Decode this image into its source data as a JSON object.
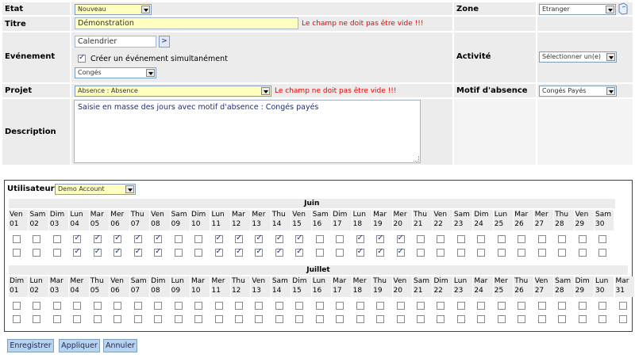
{
  "form": {
    "etat_label": "Etat",
    "etat_value": "Nouveau",
    "zone_label": "Zone",
    "zone_value": "Etranger",
    "titre_label": "Titre",
    "titre_value": "Démonstration",
    "titre_error": "Le champ ne doit pas être vide !!!",
    "evenement_label": "Evénement",
    "calendrier_value": "Calendrier",
    "calendrier_button": ">",
    "simultane_label": "Créer un événement simultanément",
    "evenement_type": "Congés",
    "activite_label": "Activité",
    "activite_value": "Sélectionner un(e)",
    "projet_label": "Projet",
    "projet_value": "Absence : Absence",
    "projet_error": "Le champ ne doit pas être vide !!!",
    "motif_label": "Motif d'absence",
    "motif_value": "Congés Payés",
    "description_label": "Description",
    "description_value": "Saisie en masse des jours avec motif d'absence : Congés payés"
  },
  "planning": {
    "user_label": "Utilisateur",
    "user_value": "Demo Account",
    "months": [
      {
        "name": "Juin",
        "days": [
          [
            "Ven",
            "01"
          ],
          [
            "Sam",
            "02"
          ],
          [
            "Dim",
            "03"
          ],
          [
            "Lun",
            "04"
          ],
          [
            "Mar",
            "05"
          ],
          [
            "Mer",
            "06"
          ],
          [
            "Thu",
            "07"
          ],
          [
            "Ven",
            "08"
          ],
          [
            "Sam",
            "09"
          ],
          [
            "Dim",
            "10"
          ],
          [
            "Lun",
            "11"
          ],
          [
            "Mar",
            "12"
          ],
          [
            "Mer",
            "13"
          ],
          [
            "Thu",
            "14"
          ],
          [
            "Ven",
            "15"
          ],
          [
            "Sam",
            "16"
          ],
          [
            "Dim",
            "17"
          ],
          [
            "Lun",
            "18"
          ],
          [
            "Mar",
            "19"
          ],
          [
            "Mer",
            "20"
          ],
          [
            "Thu",
            "21"
          ],
          [
            "Ven",
            "22"
          ],
          [
            "Sam",
            "23"
          ],
          [
            "Dim",
            "24"
          ],
          [
            "Lun",
            "25"
          ],
          [
            "Mar",
            "26"
          ],
          [
            "Mer",
            "27"
          ],
          [
            "Thu",
            "28"
          ],
          [
            "Ven",
            "29"
          ],
          [
            "Sam",
            "30"
          ]
        ],
        "checked": [
          "04",
          "05",
          "06",
          "07",
          "08",
          "11",
          "12",
          "13",
          "14",
          "15",
          "18",
          "19",
          "20"
        ]
      },
      {
        "name": "Juillet",
        "days": [
          [
            "Dim",
            "01"
          ],
          [
            "Lun",
            "02"
          ],
          [
            "Mar",
            "03"
          ],
          [
            "Mer",
            "04"
          ],
          [
            "Thu",
            "05"
          ],
          [
            "Ven",
            "06"
          ],
          [
            "Sam",
            "07"
          ],
          [
            "Dim",
            "08"
          ],
          [
            "Lun",
            "09"
          ],
          [
            "Mar",
            "10"
          ],
          [
            "Mer",
            "11"
          ],
          [
            "Thu",
            "12"
          ],
          [
            "Ven",
            "13"
          ],
          [
            "Sam",
            "14"
          ],
          [
            "Dim",
            "15"
          ],
          [
            "Lun",
            "16"
          ],
          [
            "Mar",
            "17"
          ],
          [
            "Mer",
            "18"
          ],
          [
            "Thu",
            "19"
          ],
          [
            "Ven",
            "20"
          ],
          [
            "Sam",
            "21"
          ],
          [
            "Dim",
            "22"
          ],
          [
            "Lun",
            "23"
          ],
          [
            "Mar",
            "24"
          ],
          [
            "Mer",
            "25"
          ],
          [
            "Thu",
            "26"
          ],
          [
            "Ven",
            "27"
          ],
          [
            "Sam",
            "28"
          ],
          [
            "Dim",
            "29"
          ],
          [
            "Lun",
            "30"
          ],
          [
            "Mar",
            "31"
          ]
        ],
        "checked": []
      }
    ]
  },
  "buttons": {
    "save": "Enregistrer",
    "apply": "Appliquer",
    "cancel": "Annuler"
  }
}
